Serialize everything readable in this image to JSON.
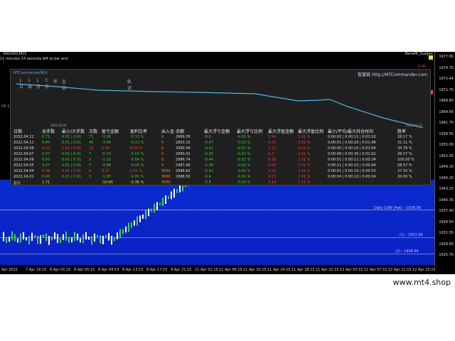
{
  "chart": {
    "symbol": "XAUUSD,M15",
    "countdown": "11 minutes 24 seconds left to bar end",
    "expert": "Benefit_Scalper",
    "expert_value": "0.00",
    "left_label": "V5.15",
    "price_ticks": [
      "1977.65",
      "1974.70",
      "1972.44",
      "1971.70",
      "1968.80",
      "1964.65",
      "1961.75",
      "1958.55",
      "1955.00",
      "1952.05",
      "1949.10",
      "1946.20",
      "1943.25",
      "1940.35",
      "1937.40",
      "1934.50",
      "1931.55",
      "1928.60",
      "1925.70"
    ],
    "time_ticks": [
      "Apr 2022",
      "7 Apr 16:15",
      "8 Apr 01:15",
      "8 Apr 05:15",
      "8 Apr 09:15",
      "8 Apr 13:15",
      "8 Apr 17:15",
      "8 Apr 21:15",
      "11 Apr 02:15",
      "11 Apr 06:15",
      "11 Apr 10:15",
      "11 Apr 14:15",
      "11 Apr 18:15",
      "11 Apr 22:15",
      "12 Apr 03:15",
      "12 Apr 07:15",
      "12 Apr 11:15",
      "12 Apr 15:15"
    ],
    "levels": [
      {
        "label": "Daily LOW (Ask) - 1938.36"
      },
      {
        "label": "(1) - 1932.00"
      },
      {
        "label": "(2) - 1928.94"
      }
    ]
  },
  "panel": {
    "title": "MTCommander统计",
    "link": "智盘链 http://MTCommander.com",
    "toolbar": [
      "1日",
      "1周",
      "1月",
      "3月",
      "年",
      "全部"
    ],
    "toolbar_extra": "轨迹",
    "date_start": "2022.04.01",
    "date_end": "2022.04.12",
    "headers": [
      "日期",
      "总手数",
      "最小/大手数",
      "次数",
      "盈亏金额",
      "盈利比率",
      "出入金",
      "余额",
      "最大浮亏金额",
      "最大浮亏比例",
      "最大浮盈金额",
      "最大浮盈比例",
      "最小/平均/最大持仓时间",
      "胜率"
    ],
    "rows": [
      [
        "2022.04.12",
        "0.71",
        "0.01 | 0.01",
        "71",
        "-3.00",
        "-0.13 %",
        "0",
        "2969.35",
        "-0.6",
        "-0.02 %",
        "3.14",
        "2.01 %",
        "0:00:02 | 0:00:11 | 0:02:10",
        "28.17 %"
      ],
      [
        "2022.04.11",
        "0.45",
        "0.01 | 0.01",
        "45",
        "-3.34",
        "-0.11 %",
        "0",
        "2953.15",
        "-0.47",
        "-0.02 %",
        "0.35",
        "2.01 %",
        "0:00:01 | 0:00:20 | 0:01:48",
        "31.11 %"
      ],
      [
        "2022.04.08",
        "0.23",
        "0.01 | 0.01",
        "23",
        "0.45",
        "0.02 %",
        "0",
        "2990.49",
        "-0.41",
        "-0.01 %",
        "1.52",
        "2.01 %",
        "0:00:00 | 0:00:15 | 0:02:09",
        "34.78 %"
      ],
      [
        "2022.04.07",
        "0.07",
        "0.01 | 0.01",
        "7",
        "-0.73",
        "-0.02 %",
        "0",
        "2990.01",
        "-0.35",
        "-0.01 %",
        "0.2",
        "2.01 %",
        "0:00:08 | 0:00:30 | 0:01:02",
        "28.57 %"
      ],
      [
        "2022.04.06",
        "0.05",
        "0.01 | 0.01",
        "5",
        "-1.22",
        "-0.04 %",
        "0",
        "2986.74",
        "-0.44",
        "-0.02 %",
        "0.29",
        "2.01 %",
        "0:00:01 | 0:00:11 | 0:00:24",
        "100.00 %"
      ],
      [
        "2022.04.05",
        "0.07",
        "0.01 | 0.01",
        "7",
        "-0.86",
        "-0.02 %",
        "0",
        "2987.96",
        "-0.48",
        "-0.02 %",
        "0.54",
        "2.01 %",
        "0:00:11 | 0:00:22 | 0:00:44",
        "28.57 %"
      ],
      [
        "2022.04.04",
        "0.08",
        "0.01 | 0.01",
        "8",
        "0.17",
        "0.01 %",
        "3000",
        "2986.62",
        "-0.41",
        "-0.01 %",
        "1.21",
        "2.01 %",
        "0:00:01 | 0:00:20 | 0:00:53",
        "37.50 %"
      ],
      [
        "2022.04.01",
        "0.05",
        "0.01 | 0.01",
        "5",
        "-1.93",
        "-0.05 %",
        "3000",
        "2998.50",
        "-0.4",
        "-0.01 %",
        "0.27",
        "2.01 %",
        "0:00:04 | 0:00:10 | 0:00:24",
        "20.00 %"
      ],
      [
        "总计",
        "1.71",
        "",
        "",
        "-10.65",
        "-0.36 %",
        "3000",
        "",
        "-0.6",
        "-0.02 %",
        "3.14",
        "2.11 %",
        "",
        ""
      ]
    ]
  },
  "watermark": "www.mt4.shop"
}
